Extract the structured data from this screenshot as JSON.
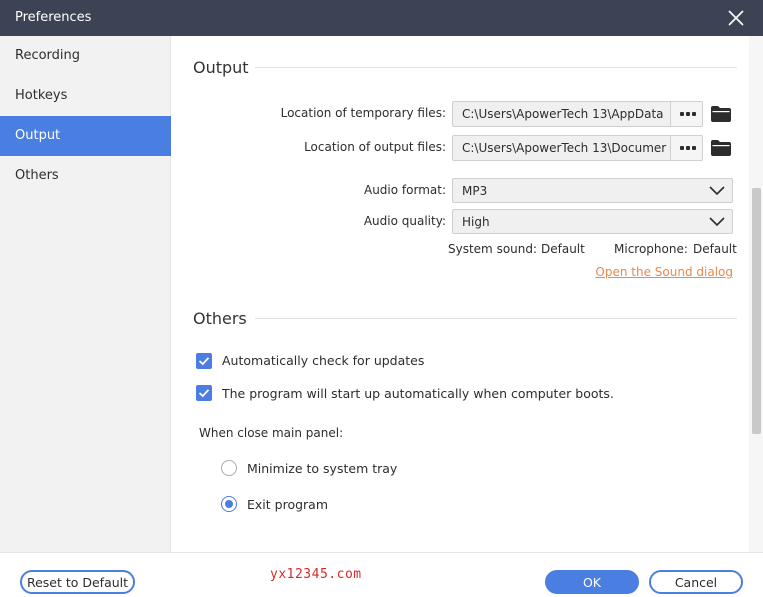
{
  "window": {
    "title": "Preferences"
  },
  "sidebar": {
    "items": [
      {
        "label": "Recording",
        "active": false
      },
      {
        "label": "Hotkeys",
        "active": false
      },
      {
        "label": "Output",
        "active": true
      },
      {
        "label": "Others",
        "active": false
      }
    ]
  },
  "output": {
    "heading": "Output",
    "temp_files": {
      "label": "Location of temporary files:",
      "value": "C:\\Users\\ApowerTech 13\\AppData"
    },
    "output_files": {
      "label": "Location of output files:",
      "value": "C:\\Users\\ApowerTech 13\\Documer"
    },
    "audio_format": {
      "label": "Audio format:",
      "value": "MP3"
    },
    "audio_quality": {
      "label": "Audio quality:",
      "value": "High"
    },
    "system_sound": {
      "label": "System sound:",
      "value": "Default"
    },
    "microphone": {
      "label": "Microphone:",
      "value": "Default"
    },
    "sound_dialog_link": "Open the Sound dialog"
  },
  "others": {
    "heading": "Others",
    "auto_update": {
      "label": "Automatically check for updates",
      "checked": true
    },
    "auto_start": {
      "label": "The program will start up automatically when computer boots.",
      "checked": true
    },
    "close_panel_label": "When close main panel:",
    "close_options": [
      {
        "label": "Minimize to system tray",
        "selected": false
      },
      {
        "label": "Exit program",
        "selected": true
      }
    ]
  },
  "footer": {
    "reset_label": "Reset to Default",
    "ok_label": "OK",
    "cancel_label": "Cancel",
    "watermark": "yx12345.com"
  },
  "colors": {
    "titlebar": "#3c4354",
    "accent": "#4a7ee0",
    "link": "#e8894d",
    "watermark": "#d62b2b"
  },
  "icons": [
    "close-icon",
    "more-dots-icon",
    "folder-icon",
    "chevron-down-icon",
    "checkmark-icon"
  ]
}
